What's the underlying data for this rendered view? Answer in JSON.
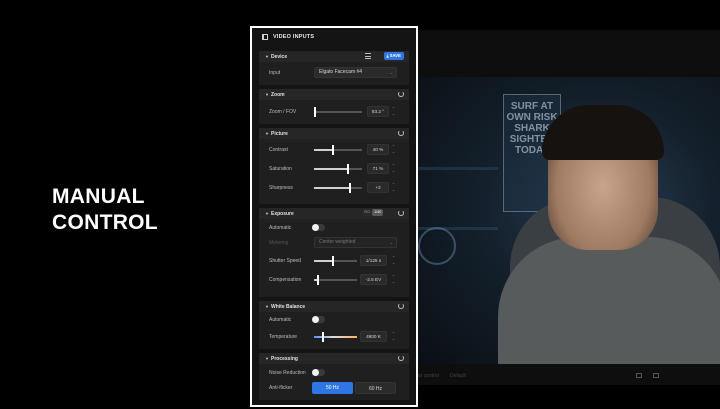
{
  "headline": {
    "line1": "MANUAL",
    "line2": "CONTROL"
  },
  "panel": {
    "title": "VIDEO INPUTS",
    "device": {
      "title": "Device",
      "save_label": "SAVE",
      "input_label": "Input",
      "input_value": "Elgato Facecam #4"
    },
    "zoom": {
      "title": "Zoom",
      "label": "Zoom / FOV",
      "value": "83.2 °",
      "level": 0.02
    },
    "picture": {
      "title": "Picture",
      "rows": [
        {
          "label": "Contrast",
          "value": "40 %",
          "level": 0.4
        },
        {
          "label": "Saturation",
          "value": "71 %",
          "level": 0.71
        },
        {
          "label": "Sharpness",
          "value": "+3",
          "level": 0.75
        }
      ]
    },
    "exposure": {
      "title": "Exposure",
      "mode_a": "ISO",
      "mode_b": "1/40",
      "automatic_label": "Automatic",
      "metering_label": "Metering",
      "metering_value": "Center weighted",
      "shutter_label": "Shutter Speed",
      "shutter_value": "1/125 s",
      "shutter_level": 0.45,
      "comp_label": "Compensation",
      "comp_value": "-2.5 EV",
      "comp_level": 0.1
    },
    "white_balance": {
      "title": "White Balance",
      "automatic_label": "Automatic",
      "temp_label": "Temperature",
      "temp_value": "4900 K",
      "temp_level": 0.2
    },
    "processing": {
      "title": "Processing",
      "noise_label": "Noise Reduction",
      "antiflicker_label": "Anti-flicker",
      "opt_50": "50 Hz",
      "opt_60": "60 Hz"
    }
  },
  "background": {
    "sign_text": "SURF AT OWN RISK SHARK SIGHTED TODAY",
    "bottom_left": "Auto control",
    "bottom_mid": "Default"
  },
  "colors": {
    "accent": "#2f76e5",
    "panel_bg": "#141414",
    "section_bg": "#1f1f1f"
  }
}
